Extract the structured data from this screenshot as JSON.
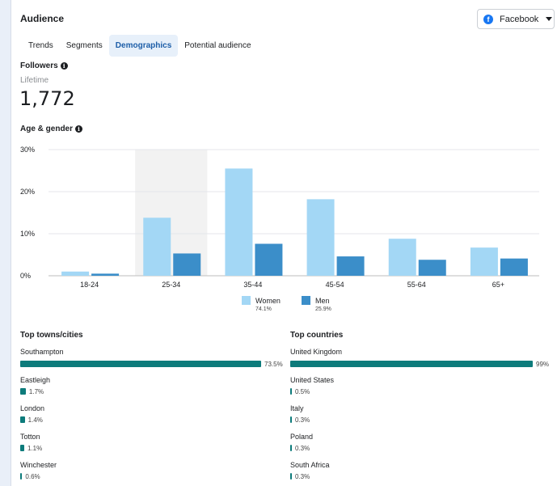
{
  "section": {
    "title": "Audience"
  },
  "platform": {
    "label": "Facebook",
    "icon": "facebook-icon"
  },
  "tabs": [
    {
      "label": "Trends",
      "active": false
    },
    {
      "label": "Segments",
      "active": false
    },
    {
      "label": "Demographics",
      "active": true
    },
    {
      "label": "Potential audience",
      "active": false
    }
  ],
  "followers": {
    "title": "Followers",
    "period": "Lifetime",
    "count": "1,772"
  },
  "age_gender": {
    "title": "Age & gender"
  },
  "chart_data": {
    "type": "bar",
    "categories": [
      "18-24",
      "25-34",
      "35-44",
      "45-54",
      "55-64",
      "65+"
    ],
    "series": [
      {
        "name": "Women",
        "values": [
          1.0,
          13.8,
          25.5,
          18.2,
          8.8,
          6.7
        ],
        "color": "#a3d7f5",
        "share": "74.1%"
      },
      {
        "name": "Men",
        "values": [
          0.5,
          5.3,
          7.6,
          4.6,
          3.8,
          4.1
        ],
        "color": "#3b8ec9",
        "share": "25.9%"
      }
    ],
    "ylim": [
      0,
      30
    ],
    "yticks": [
      "0%",
      "10%",
      "20%",
      "30%"
    ],
    "highlighted_category": "25-34",
    "grid": true,
    "legend": "bottom-center"
  },
  "towns": {
    "title": "Top towns/cities",
    "items": [
      {
        "name": "Southampton",
        "pct": "73.5%",
        "value": 73.5
      },
      {
        "name": "Eastleigh",
        "pct": "1.7%",
        "value": 1.7
      },
      {
        "name": "London",
        "pct": "1.4%",
        "value": 1.4
      },
      {
        "name": "Totton",
        "pct": "1.1%",
        "value": 1.1
      },
      {
        "name": "Winchester",
        "pct": "0.6%",
        "value": 0.6
      }
    ]
  },
  "countries": {
    "title": "Top countries",
    "items": [
      {
        "name": "United Kingdom",
        "pct": "99%",
        "value": 99
      },
      {
        "name": "United States",
        "pct": "0.5%",
        "value": 0.5
      },
      {
        "name": "Italy",
        "pct": "0.3%",
        "value": 0.3
      },
      {
        "name": "Poland",
        "pct": "0.3%",
        "value": 0.3
      },
      {
        "name": "South Africa",
        "pct": "0.3%",
        "value": 0.3
      }
    ]
  },
  "colors": {
    "accent": "#1877f2",
    "bar_list": "#0d7b7b",
    "tab_active_bg": "#e7f0fa"
  }
}
